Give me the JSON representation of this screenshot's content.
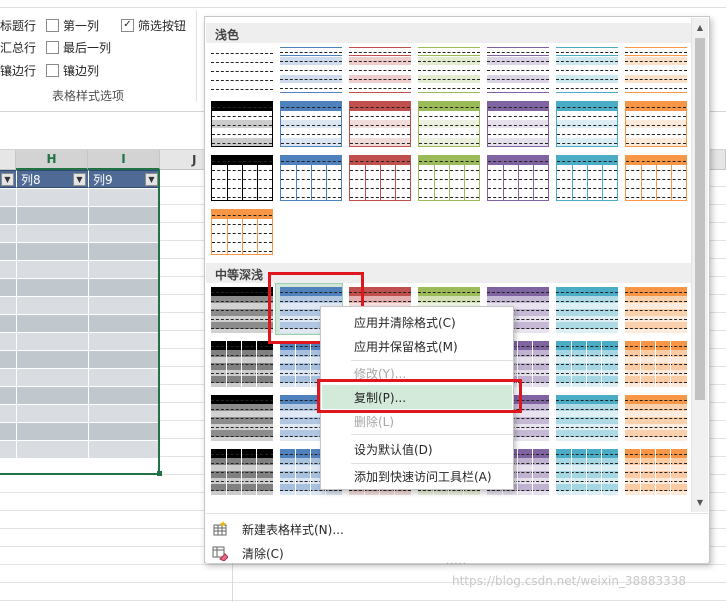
{
  "ribbon": {
    "options": [
      {
        "label": "标题行",
        "checked": false,
        "col": 0
      },
      {
        "label": "汇总行",
        "checked": false,
        "col": 0
      },
      {
        "label": "镶边行",
        "checked": false,
        "col": 0
      },
      {
        "label": "第一列",
        "checked": false,
        "col": 1
      },
      {
        "label": "最后一列",
        "checked": false,
        "col": 1
      },
      {
        "label": "镶边列",
        "checked": false,
        "col": 1
      },
      {
        "label": "筛选按钮",
        "checked": true,
        "col": 2
      }
    ],
    "group_label": "表格样式选项"
  },
  "sheet": {
    "columns": [
      "H",
      "I",
      "J"
    ],
    "table_headers": [
      "列8",
      "列9"
    ],
    "dropdown_glyph": "▼"
  },
  "gallery": {
    "section_light": "浅色",
    "section_medium": "中等深浅",
    "footer": {
      "new_style": "新建表格样式(N)...",
      "clear": "清除(C)",
      "grip": "....."
    },
    "colors": [
      "#000000",
      "#4f81bd",
      "#c0504d",
      "#9bbb59",
      "#8064a2",
      "#4bacc6",
      "#f79646"
    ]
  },
  "context_menu": {
    "items": [
      {
        "label": "应用并清除格式(C)",
        "disabled": false
      },
      {
        "label": "应用并保留格式(M)",
        "disabled": false
      },
      {
        "label": "修改(Y)...",
        "disabled": true
      },
      {
        "label": "复制(P)...",
        "disabled": false,
        "hover": true
      },
      {
        "label": "删除(L)",
        "disabled": true
      },
      {
        "label": "设为默认值(D)",
        "disabled": false
      },
      {
        "label": "添加到快速访问工具栏(A)",
        "disabled": false
      }
    ]
  },
  "watermark": "https://blog.csdn.net/weixin_38883338"
}
